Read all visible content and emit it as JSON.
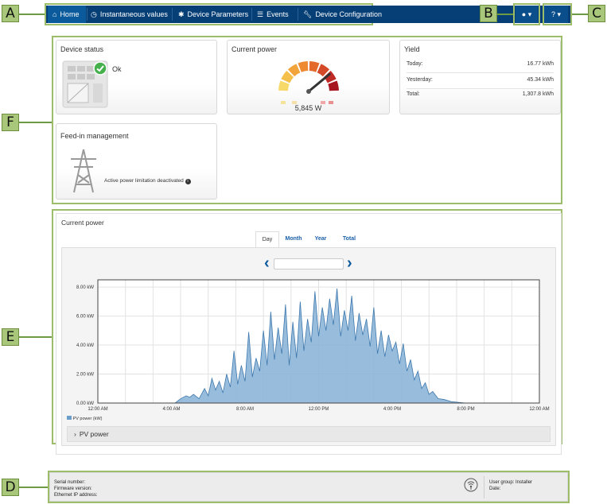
{
  "callouts": {
    "a": "A",
    "b": "B",
    "c": "C",
    "d": "D",
    "e": "E",
    "f": "F"
  },
  "nav": {
    "home": "Home",
    "instantaneous": "Instantaneous values",
    "parameters": "Device Parameters",
    "events": "Events",
    "configuration": "Device Configuration",
    "user_caret": "▾",
    "help_caret": "▾"
  },
  "status": {
    "title": "Device status",
    "value": "Ok"
  },
  "power_gauge": {
    "title": "Current power",
    "value": "5,845 W",
    "level": 0.78
  },
  "yield": {
    "title": "Yield",
    "rows": [
      {
        "label": "Today:",
        "value": "16.77 kWh"
      },
      {
        "label": "Yesterday:",
        "value": "45.34 kWh"
      },
      {
        "label": "Total:",
        "value": "1,307.8 kWh"
      }
    ]
  },
  "feedin": {
    "title": "Feed-in management",
    "text": "Active power limitation deactivated"
  },
  "chart_panel": {
    "title": "Current power",
    "tabs": [
      "Day",
      "Month",
      "Year",
      "Total"
    ],
    "date_value": "",
    "accordion": "PV power"
  },
  "chart_data": {
    "type": "area",
    "series": [
      {
        "name": "PV power (kW)",
        "color": "#6a9ec9"
      }
    ],
    "y_ticks": [
      "8.00 kW",
      "6.00 kW",
      "4.00 kW",
      "2.00 kW",
      "0.00 kW"
    ],
    "x_ticks": [
      "12:00 AM",
      "4:00 AM",
      "8:00 AM",
      "12:00 PM",
      "4:00 PM",
      "8:00 PM",
      "12:00 AM"
    ],
    "ylim": [
      0,
      8.5
    ],
    "xlim": [
      0,
      24
    ],
    "x": [
      0,
      4.2,
      4.5,
      4.8,
      5.0,
      5.2,
      5.5,
      5.8,
      6.0,
      6.2,
      6.4,
      6.6,
      6.8,
      7.0,
      7.2,
      7.4,
      7.6,
      7.8,
      8.0,
      8.2,
      8.4,
      8.6,
      8.8,
      9.0,
      9.2,
      9.4,
      9.6,
      9.8,
      10.0,
      10.2,
      10.4,
      10.6,
      10.8,
      11.0,
      11.2,
      11.4,
      11.6,
      11.8,
      12.0,
      12.2,
      12.4,
      12.6,
      12.8,
      13.0,
      13.2,
      13.4,
      13.6,
      13.8,
      14.0,
      14.2,
      14.4,
      14.6,
      14.8,
      15.0,
      15.2,
      15.4,
      15.6,
      15.8,
      16.0,
      16.2,
      16.4,
      16.6,
      16.8,
      17.0,
      17.2,
      17.4,
      17.6,
      17.8,
      18.0,
      18.2,
      18.5,
      18.8,
      19.2,
      19.6,
      20.0,
      24
    ],
    "values": [
      0,
      0,
      0.3,
      0.5,
      0.4,
      0.6,
      0.3,
      1.0,
      0.5,
      1.7,
      0.9,
      1.5,
      0.7,
      2.0,
      1.1,
      3.6,
      1.3,
      2.6,
      1.5,
      4.9,
      1.8,
      3.1,
      2.2,
      5.0,
      2.6,
      6.3,
      3.0,
      5.2,
      3.4,
      6.8,
      2.6,
      5.6,
      3.1,
      7.0,
      3.6,
      5.8,
      4.2,
      7.7,
      4.6,
      6.6,
      5.0,
      7.2,
      5.4,
      7.9,
      4.6,
      6.4,
      5.0,
      7.4,
      4.3,
      6.2,
      4.7,
      5.8,
      3.9,
      6.6,
      3.4,
      5.0,
      3.2,
      4.7,
      3.6,
      4.2,
      2.7,
      4.1,
      2.2,
      3.0,
      1.6,
      2.2,
      1.0,
      1.4,
      0.6,
      0.8,
      0.3,
      0.25,
      0.1,
      0.05,
      0,
      0
    ]
  },
  "footer": {
    "serial_label": "Serial number:",
    "firmware_label": "Firmware version:",
    "ip_label": "Ethernet IP address:",
    "usergroup": "User group: Installer",
    "date_label": "Date:"
  }
}
